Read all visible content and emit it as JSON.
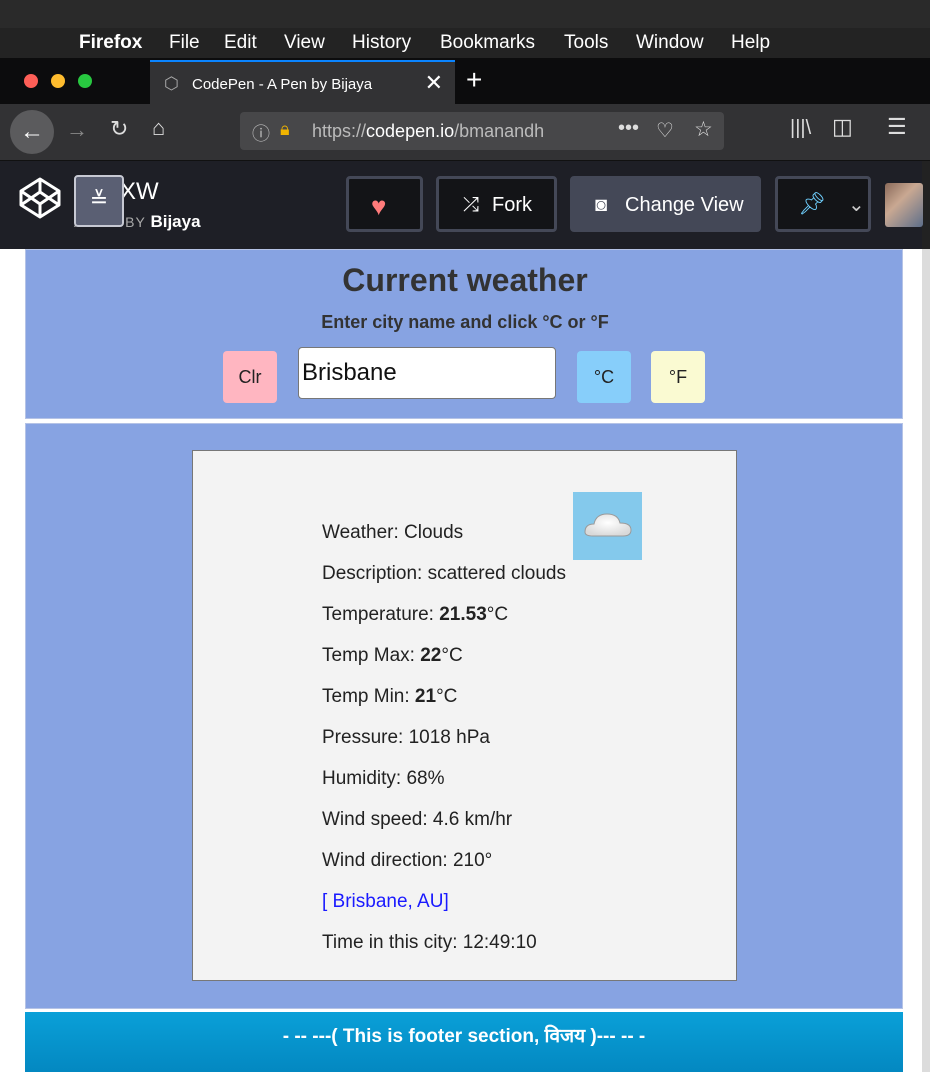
{
  "menubar": {
    "app": "Firefox",
    "items": [
      "File",
      "Edit",
      "View",
      "History",
      "Bookmarks",
      "Tools",
      "Window",
      "Help"
    ]
  },
  "tab": {
    "title": "CodePen - A Pen by Bijaya",
    "close": "✕",
    "new": "+"
  },
  "urlbar": {
    "url_prefix": "https://",
    "url_domain": "codepen.io",
    "url_path": "/bmanandh"
  },
  "codepen": {
    "pen_title": "XW",
    "by_label": "A PEN BY",
    "author": "Bijaya",
    "fork_label": "Fork",
    "change_view_label": "Change View"
  },
  "weather_app": {
    "heading": "Current weather",
    "instruction": "Enter city name and click °C or °F",
    "clear_label": "Clr",
    "city_value": "Brisbane",
    "celsius_label": "°C",
    "fahrenheit_label": "°F"
  },
  "result": {
    "weather": "Weather: Clouds",
    "description": "Description: scattered clouds",
    "temp_prefix": "Temperature: ",
    "temp_value": "21.53",
    "temp_unit": "°C",
    "tmax_prefix": "Temp Max: ",
    "tmax_value": "22",
    "tmax_unit": "°C",
    "tmin_prefix": "Temp Min: ",
    "tmin_value": "21",
    "tmin_unit": "°C",
    "pressure": "Pressure: 1018 hPa",
    "humidity": "Humidity: 68%",
    "wind_speed": "Wind speed: 4.6 km/hr",
    "wind_direction": "Wind direction: 210°",
    "location": "[ Brisbane, AU]",
    "time": "Time in this city: 12:49:10"
  },
  "footer": {
    "text": "- -- ---( This is footer section, विजय )--- -- -"
  },
  "colors": {
    "panel": "#87a3e2",
    "clear_btn": "#ffb6c1",
    "c_btn": "#87cefa",
    "f_btn": "#fafad2",
    "footer": "#0399d0"
  }
}
